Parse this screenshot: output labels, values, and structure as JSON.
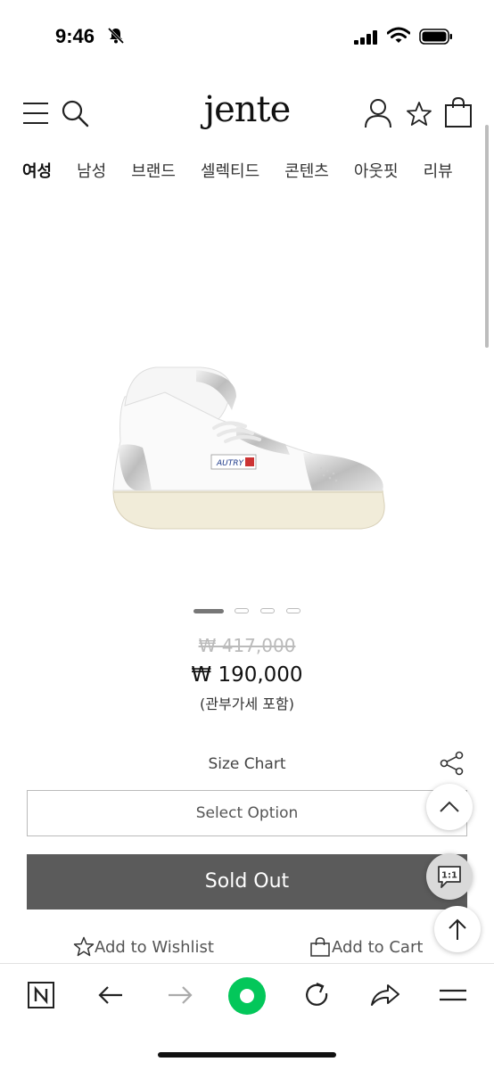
{
  "status": {
    "time": "9:46"
  },
  "header": {
    "logo": "jente"
  },
  "nav": {
    "items": [
      "여성",
      "남성",
      "브랜드",
      "셀렉티드",
      "콘텐츠",
      "아웃핏",
      "리뷰"
    ]
  },
  "product": {
    "image_label": "AUTRY",
    "gallery": {
      "total": 4,
      "current": 1
    },
    "original_price": "₩ 417,000",
    "price": "₩ 190,000",
    "tax_note": "(관부가세 포함)"
  },
  "actions": {
    "size_chart": "Size Chart",
    "select_placeholder": "Select Option",
    "sold_out": "Sold Out",
    "wishlist": "Add to Wishlist",
    "cart": "Add to Cart"
  },
  "floating": {
    "chat_label": "1:1"
  },
  "colors": {
    "sold_out_bg": "#5b5b5b",
    "browser_accent": "#03c75a"
  }
}
